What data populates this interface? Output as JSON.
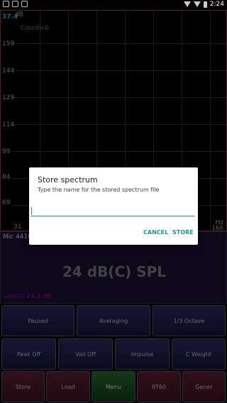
{
  "status_bar": {
    "time": "2:24"
  },
  "graph": {
    "unit": "dB",
    "top_value": "37.4",
    "count_label": "Count=0",
    "y_ticks": [
      "159",
      "144",
      "129",
      "114",
      "99",
      "84",
      "69"
    ],
    "x_start": "31",
    "x_unit": "Hz",
    "x_end": "16k"
  },
  "panel": {
    "mic_label": "Mic 44100",
    "spl_value": "24 dB(C) SPL",
    "leq_label": "Leq(C)",
    "leq_value": "24.2 dB"
  },
  "buttons": {
    "row1": [
      "Paused",
      "Averaging",
      "1/3 Octave"
    ],
    "row2": [
      "Peak Off",
      "Vall Off",
      "Impulse",
      "C Weight"
    ],
    "row3": [
      "Store",
      "Load",
      "Menu",
      "RT60",
      "Gener"
    ]
  },
  "dialog": {
    "title": "Store spectrum",
    "message": "Type the name for the stored spectrum file",
    "input_value": "",
    "cancel_label": "CANCEL",
    "store_label": "STORE"
  }
}
